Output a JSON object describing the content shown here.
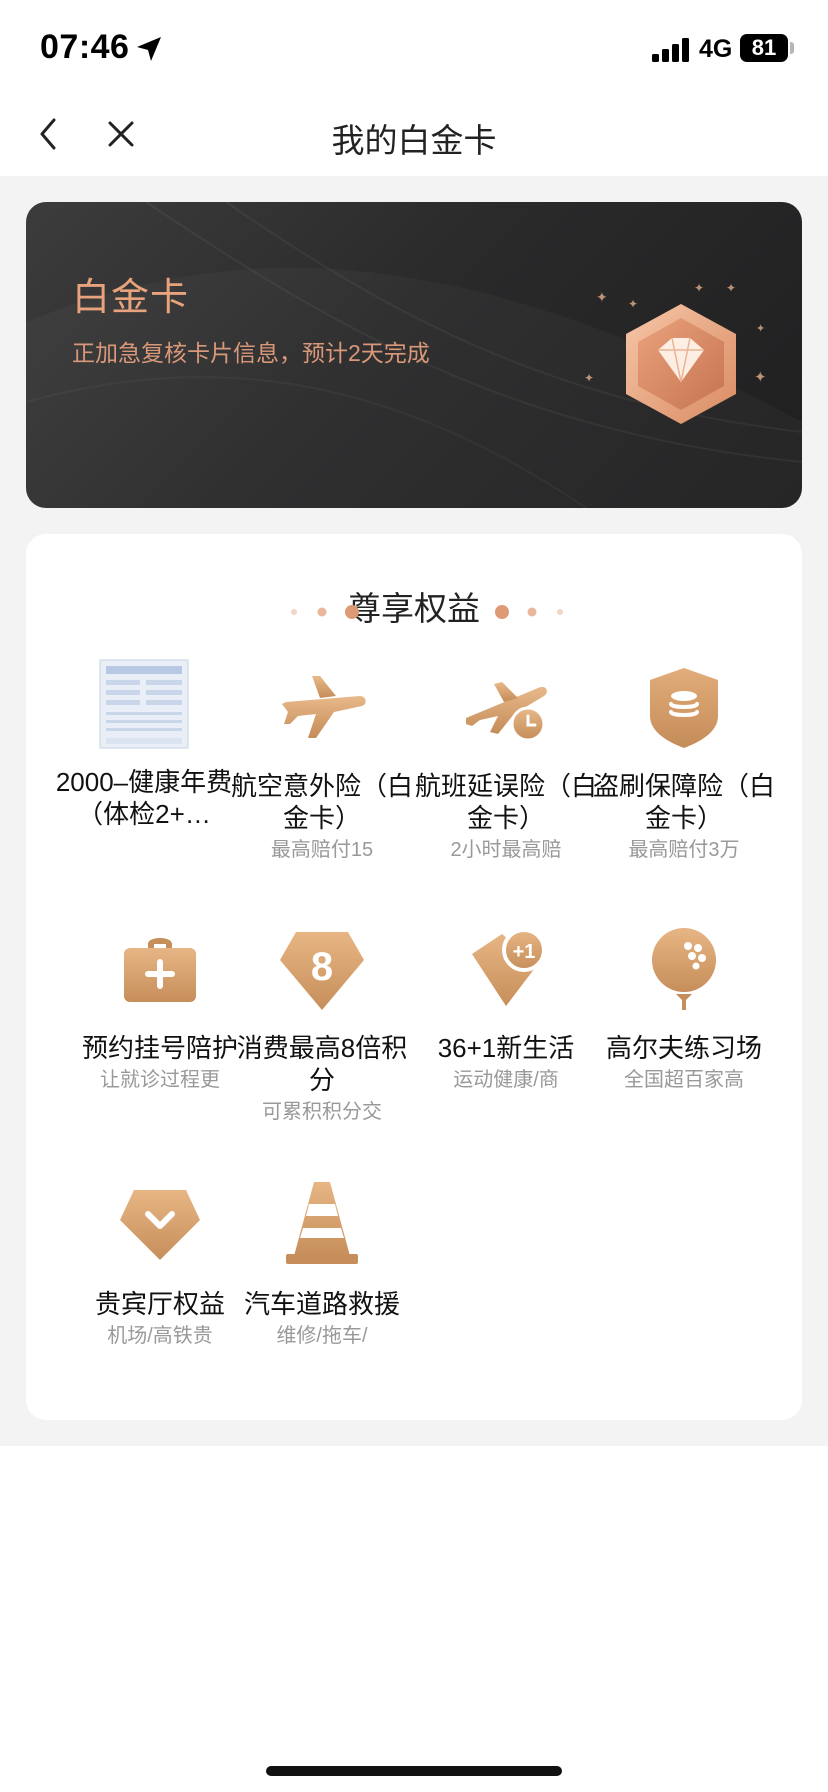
{
  "status_bar": {
    "time": "07:46",
    "network": "4G",
    "battery": "81",
    "icons": [
      "location-arrow-icon",
      "signal-bars-icon",
      "battery-icon"
    ]
  },
  "nav": {
    "title": "我的白金卡",
    "icons": [
      "back-chevron-icon",
      "close-icon"
    ]
  },
  "card": {
    "title": "白金卡",
    "subtitle": "正加急复核卡片信息，预计2天完成",
    "badge_icon": "diamond-hexagon-icon",
    "accent_color": "#e8a37c"
  },
  "benefits": {
    "title": "尊享权益",
    "items": [
      {
        "label": "2000–健康年费（体检2+…",
        "sub": "",
        "icon": "document-thumbnail-icon"
      },
      {
        "label": "航空意外险（白金卡）",
        "sub": "最高赔付15",
        "icon": "airplane-icon"
      },
      {
        "label": "航班延误险（白金卡）",
        "sub": "2小时最高赔",
        "icon": "plane-clock-icon"
      },
      {
        "label": "盗刷保障险（白金卡）",
        "sub": "最高赔付3万",
        "icon": "shield-coins-icon"
      },
      {
        "label": "预约挂号陪护",
        "sub": "让就诊过程更",
        "icon": "medical-kit-icon"
      },
      {
        "label": "消费最高8倍积分",
        "sub": "可累积积分交",
        "icon": "points-8-icon"
      },
      {
        "label": "36+1新生活",
        "sub": "运动健康/商",
        "icon": "tag-plus-one-icon"
      },
      {
        "label": "高尔夫练习场",
        "sub": "全国超百家高",
        "icon": "golf-ball-icon"
      },
      {
        "label": "贵宾厅权益",
        "sub": "机场/高铁贵",
        "icon": "vip-diamond-icon"
      },
      {
        "label": "汽车道路救援",
        "sub": "维修/拖车/",
        "icon": "traffic-cone-icon"
      }
    ]
  },
  "colors": {
    "gold": "#d4a070",
    "gold_dark": "#b98552",
    "card_dark": "#2a2a2b"
  }
}
